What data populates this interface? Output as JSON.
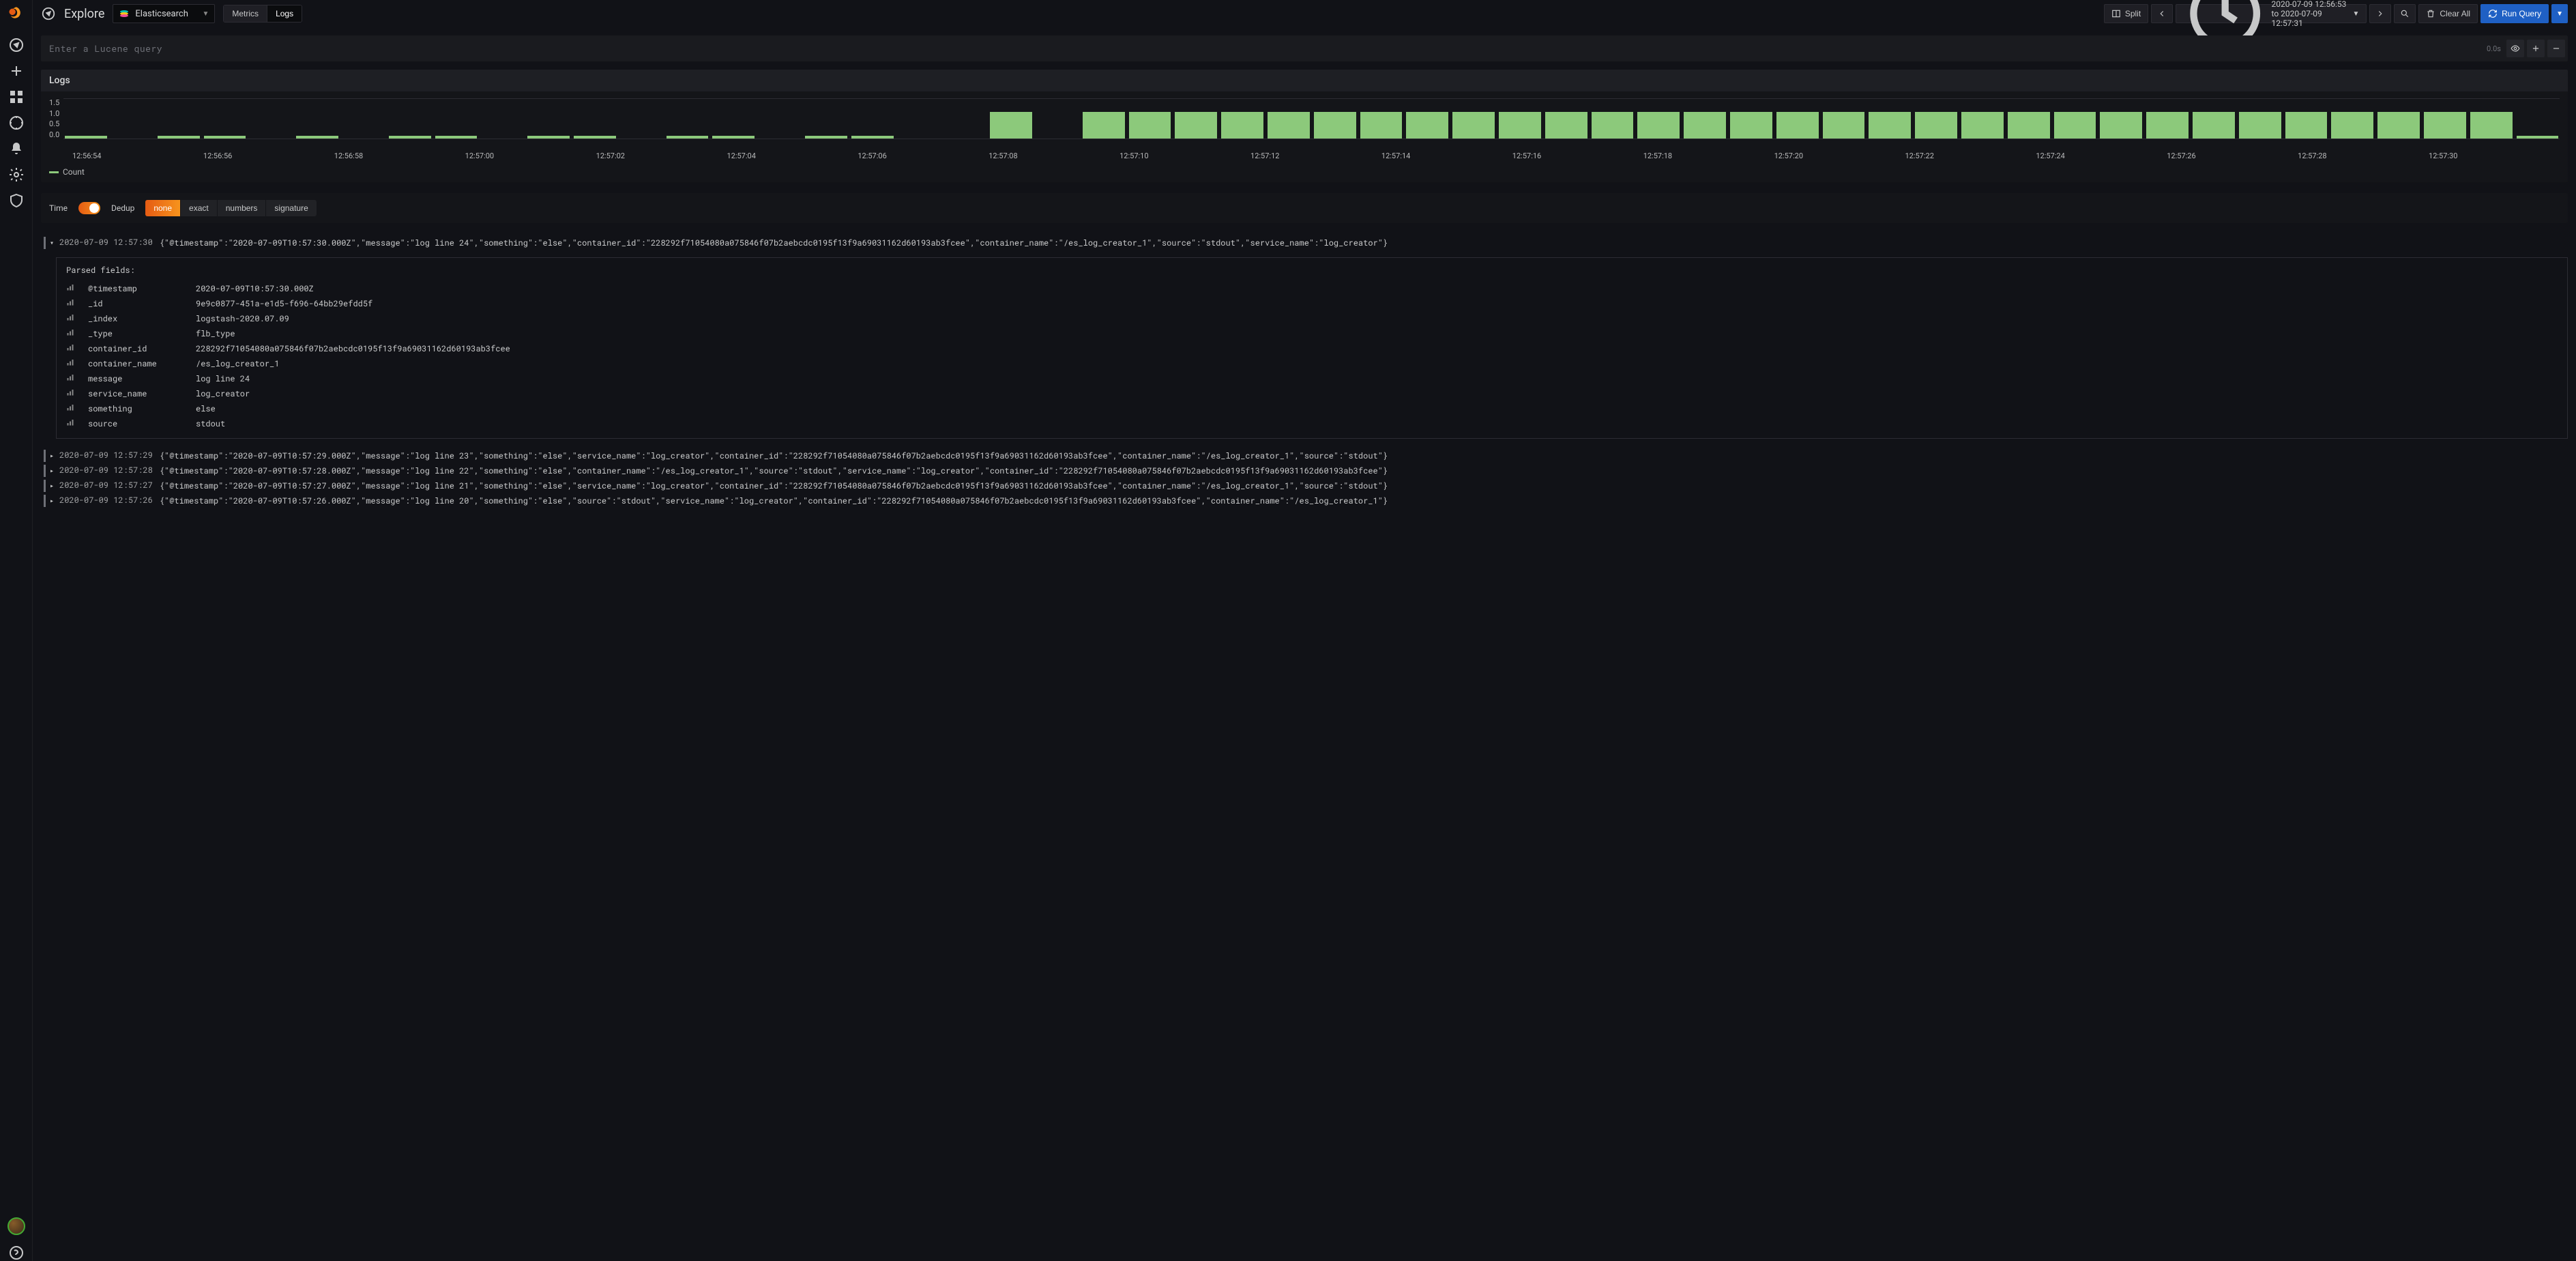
{
  "title": "Explore",
  "datasource": "Elasticsearch",
  "modes": {
    "metrics": "Metrics",
    "logs": "Logs",
    "active": "logs"
  },
  "toolbar": {
    "split": "Split",
    "time_range": "2020-07-09 12:56:53 to 2020-07-09 12:57:31",
    "clear": "Clear All",
    "run": "Run Query"
  },
  "query": {
    "placeholder": "Enter a Lucene query",
    "elapsed": "0.0s"
  },
  "logs_panel_title": "Logs",
  "legend_label": "Count",
  "controls": {
    "time_label": "Time",
    "dedup_label": "Dedup",
    "dedup_options": [
      "none",
      "exact",
      "numbers",
      "signature"
    ],
    "dedup_active": "none"
  },
  "chart_data": {
    "type": "bar",
    "ylabel": "",
    "xlabel": "",
    "ylim": [
      0,
      1.5
    ],
    "y_ticks": [
      "1.5",
      "1.0",
      "0.5",
      "0.0"
    ],
    "x_ticks": [
      "12:56:54",
      "12:56:56",
      "12:56:58",
      "12:57:00",
      "12:57:02",
      "12:57:04",
      "12:57:06",
      "12:57:08",
      "12:57:10",
      "12:57:12",
      "12:57:14",
      "12:57:16",
      "12:57:18",
      "12:57:20",
      "12:57:22",
      "12:57:24",
      "12:57:26",
      "12:57:28",
      "12:57:30"
    ],
    "series": [
      {
        "name": "Count",
        "values": [
          0.1,
          0,
          0.1,
          0.1,
          0,
          0.1,
          0,
          0.1,
          0.1,
          0,
          0.1,
          0.1,
          0,
          0.1,
          0.1,
          0,
          0.1,
          0.1,
          0,
          0,
          1,
          0,
          1,
          1,
          1,
          1,
          1,
          1,
          1,
          1,
          1,
          1,
          1,
          1,
          1,
          1,
          1,
          1,
          1,
          1,
          1,
          1,
          1,
          1,
          1,
          1,
          1,
          1,
          1,
          1,
          1,
          1,
          1,
          0.1
        ]
      }
    ]
  },
  "parsed_title": "Parsed fields:",
  "parsed_fields": [
    {
      "k": "@timestamp",
      "v": "2020-07-09T10:57:30.000Z"
    },
    {
      "k": "_id",
      "v": "9e9c0877-451a-e1d5-f696-64bb29efdd5f"
    },
    {
      "k": "_index",
      "v": "logstash-2020.07.09"
    },
    {
      "k": "_type",
      "v": "flb_type"
    },
    {
      "k": "container_id",
      "v": "228292f71054080a075846f07b2aebcdc0195f13f9a69031162d60193ab3fcee"
    },
    {
      "k": "container_name",
      "v": "/es_log_creator_1"
    },
    {
      "k": "message",
      "v": "log line 24"
    },
    {
      "k": "service_name",
      "v": "log_creator"
    },
    {
      "k": "something",
      "v": "else"
    },
    {
      "k": "source",
      "v": "stdout"
    }
  ],
  "log_rows": [
    {
      "expanded": true,
      "ts": "2020-07-09 12:57:30",
      "msg": "{\"@timestamp\":\"2020-07-09T10:57:30.000Z\",\"message\":\"log line 24\",\"something\":\"else\",\"container_id\":\"228292f71054080a075846f07b2aebcdc0195f13f9a69031162d60193ab3fcee\",\"container_name\":\"/es_log_creator_1\",\"source\":\"stdout\",\"service_name\":\"log_creator\"}"
    },
    {
      "expanded": false,
      "ts": "2020-07-09 12:57:29",
      "msg": "{\"@timestamp\":\"2020-07-09T10:57:29.000Z\",\"message\":\"log line 23\",\"something\":\"else\",\"service_name\":\"log_creator\",\"container_id\":\"228292f71054080a075846f07b2aebcdc0195f13f9a69031162d60193ab3fcee\",\"container_name\":\"/es_log_creator_1\",\"source\":\"stdout\"}"
    },
    {
      "expanded": false,
      "ts": "2020-07-09 12:57:28",
      "msg": "{\"@timestamp\":\"2020-07-09T10:57:28.000Z\",\"message\":\"log line 22\",\"something\":\"else\",\"container_name\":\"/es_log_creator_1\",\"source\":\"stdout\",\"service_name\":\"log_creator\",\"container_id\":\"228292f71054080a075846f07b2aebcdc0195f13f9a69031162d60193ab3fcee\"}"
    },
    {
      "expanded": false,
      "ts": "2020-07-09 12:57:27",
      "msg": "{\"@timestamp\":\"2020-07-09T10:57:27.000Z\",\"message\":\"log line 21\",\"something\":\"else\",\"service_name\":\"log_creator\",\"container_id\":\"228292f71054080a075846f07b2aebcdc0195f13f9a69031162d60193ab3fcee\",\"container_name\":\"/es_log_creator_1\",\"source\":\"stdout\"}"
    },
    {
      "expanded": false,
      "ts": "2020-07-09 12:57:26",
      "msg": "{\"@timestamp\":\"2020-07-09T10:57:26.000Z\",\"message\":\"log line 20\",\"something\":\"else\",\"source\":\"stdout\",\"service_name\":\"log_creator\",\"container_id\":\"228292f71054080a075846f07b2aebcdc0195f13f9a69031162d60193ab3fcee\",\"container_name\":\"/es_log_creator_1\"}"
    }
  ]
}
